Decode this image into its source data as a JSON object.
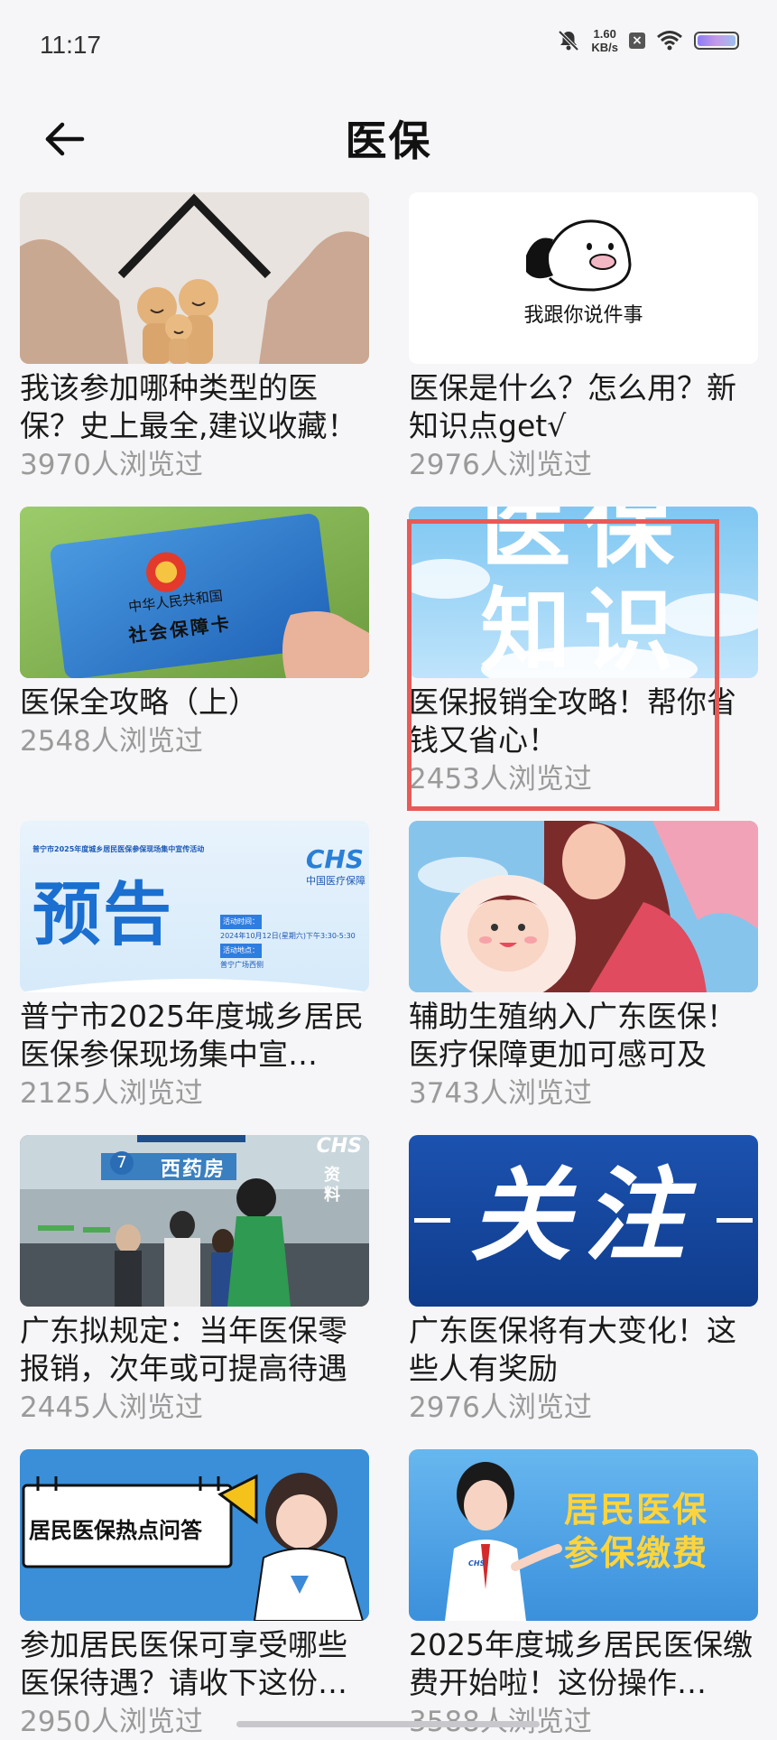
{
  "status_bar": {
    "time": "11:17",
    "net_speed_value": "1.60",
    "net_speed_unit": "KB/s",
    "notif_badge": "×",
    "battery_level": 1.0
  },
  "header": {
    "title": "医保"
  },
  "thumb_text": {
    "card2_caption": "我跟你说件事",
    "card3_country": "中华人民共和国",
    "card3_label": "社会保障卡",
    "card4_line1": "医保",
    "card4_line2": "知识",
    "card5_banner": "普宁市2025年度城乡居民医保参保现场集中宣传活动",
    "card5_big": "预告",
    "card5_chs": "CHS",
    "card5_chs_sub": "中国医疗保障",
    "card5_info1": "活动时间：",
    "card5_info2": "2024年10月12日(星期六)下午3:30-5:30",
    "card5_info3": "活动地点：",
    "card5_info4": "普宁广场西侧",
    "card7_sign": "西药房",
    "card7_num": "7",
    "card7_corner1": "CHS",
    "card7_corner2": "资料",
    "card8_text": "关注",
    "card9_text": "居民医保热点问答",
    "card10_line1": "居民医保",
    "card10_line2": "参保缴费",
    "card10_badge": "CHS"
  },
  "articles": [
    {
      "title": "我该参加哪种类型的医保？史上最全,建议收藏！",
      "views": "3970人浏览过"
    },
    {
      "title": "医保是什么？怎么用？新知识点get√",
      "views": "2976人浏览过"
    },
    {
      "title": "医保全攻略（上）",
      "views": "2548人浏览过"
    },
    {
      "title": "医保报销全攻略！帮你省钱又省心！",
      "views": "2453人浏览过"
    },
    {
      "title": "普宁市2025年度城乡居民医保参保现场集中宣…",
      "views": "2125人浏览过"
    },
    {
      "title": "辅助生殖纳入广东医保！医疗保障更加可感可及",
      "views": "3743人浏览过"
    },
    {
      "title": "广东拟规定：当年医保零报销，次年或可提高待遇",
      "views": "2445人浏览过"
    },
    {
      "title": "广东医保将有大变化！这些人有奖励",
      "views": "2976人浏览过"
    },
    {
      "title": "参加居民医保可享受哪些医保待遇？请收下这份…",
      "views": "2950人浏览过"
    },
    {
      "title": "2025年度城乡居民医保缴费开始啦！这份操作…",
      "views": "3588人浏览过"
    }
  ],
  "colors": {
    "highlight": "#e85a57",
    "views_text": "#9a9a9a",
    "background": "#f6f6f8"
  }
}
